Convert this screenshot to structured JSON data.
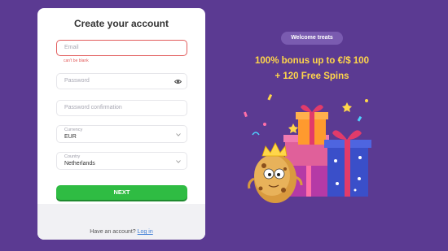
{
  "form": {
    "title": "Create your account",
    "email_placeholder": "Email",
    "email_error": "can't be blank",
    "password_placeholder": "Password",
    "password_confirm_placeholder": "Password confirmation",
    "currency_label": "Currency",
    "currency_value": "EUR",
    "country_label": "Country",
    "country_value": "Netherlands",
    "next_label": "NEXT",
    "have_account_text": "Have an account?",
    "login_link": "Log in"
  },
  "promo": {
    "badge": "Welcome treats",
    "line1": "100% bonus up to €/$ 100",
    "line2": "+ 120 Free Spins"
  },
  "colors": {
    "background": "#5b3a92",
    "accent_green": "#2fbc43",
    "promo_yellow": "#ffd64a",
    "error_red": "#e25c5c",
    "link_blue": "#3a7bd5"
  },
  "icons": [
    "eye-icon",
    "chevron-down-icon",
    "cookie-mascot",
    "gift-boxes"
  ]
}
